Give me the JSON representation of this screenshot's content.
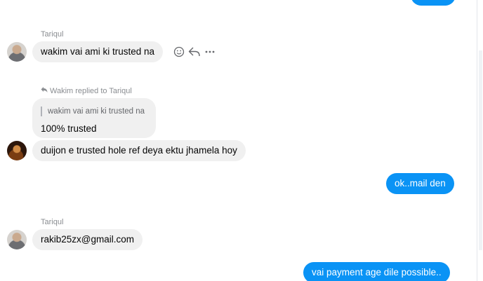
{
  "messages": {
    "out_top": {
      "text": ""
    },
    "group1": {
      "sender": "Tariqul",
      "text": "wakim vai ami ki trusted na",
      "actions": [
        "smiley-icon",
        "reply-icon",
        "more-icon"
      ]
    },
    "reply": {
      "header": "Wakim replied to Tariqul",
      "quoted": "wakim vai ami ki trusted na",
      "text": "100% trusted"
    },
    "wakim_msg": {
      "text": "duijon e trusted hole ref deya ektu jhamela hoy"
    },
    "out_mail": {
      "text": "ok..mail den"
    },
    "group2": {
      "sender": "Tariqul",
      "text": "rakib25zx@gmail.com"
    },
    "out_payment": {
      "text": "vai  payment age dile possible.."
    }
  },
  "colors": {
    "outgoing_bubble": "#0a93f5",
    "incoming_bubble": "#f0f0f0",
    "meta_text": "#8a8d91"
  }
}
